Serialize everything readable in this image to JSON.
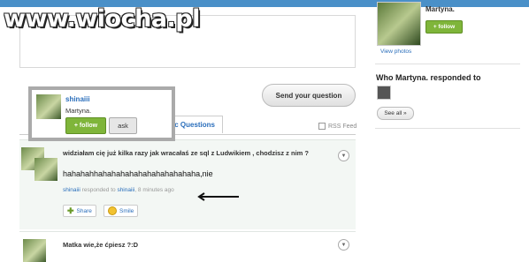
{
  "watermark": "www.wiocha.pl",
  "composer": {
    "send_label": "Send your question"
  },
  "tabs": {
    "public_label": "blic Questions",
    "rss_label": "RSS Feed"
  },
  "hover_card": {
    "username": "shinaiii",
    "real_name": "Martyna.",
    "follow_label": "+ follow",
    "ask_label": "ask"
  },
  "questions": [
    {
      "question": "widziałam cię już kilka razy jak wracałaś ze sql z Ludwikiem , chodzisz z nim ?",
      "answer": "hahahahhahahahahahahahahahahaha,nie",
      "meta_user": "shinaiii",
      "meta_text": " responded to ",
      "meta_user2": "shinaiii",
      "meta_time": ", 8 minutes ago",
      "share_label": "Share",
      "smile_label": "Smile"
    },
    {
      "question": "Matka wie,że ćpiesz ?:D"
    }
  ],
  "sidebar": {
    "profile_name": "Martyna.",
    "follow_label": "+ follow",
    "view_photos": "View photos",
    "responded_title": "Who Martyna. responded to",
    "see_all": "See all »"
  },
  "colors": {
    "accent_green": "#7fb53a",
    "link_blue": "#2a6ebb",
    "question_bg": "#f3f7f4"
  }
}
